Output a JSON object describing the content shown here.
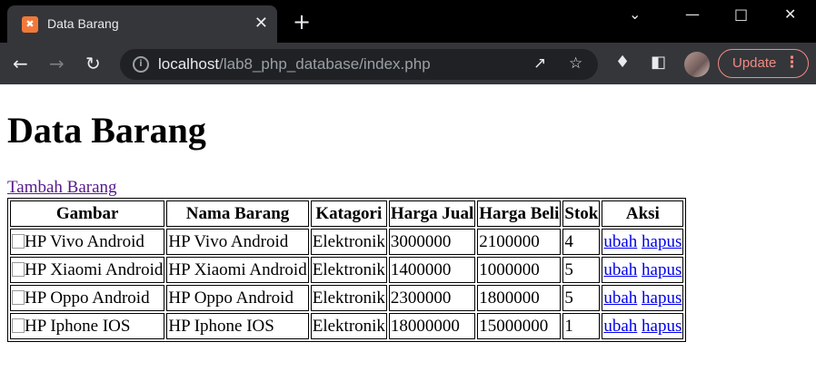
{
  "browser": {
    "tab_title": "Data Barang",
    "url_host": "localhost",
    "url_path": "/lab8_php_database/index.php",
    "update_label": "Update"
  },
  "page": {
    "heading": "Data Barang",
    "add_link": "Tambah Barang",
    "columns": [
      "Gambar",
      "Nama Barang",
      "Katagori",
      "Harga Jual",
      "Harga Beli",
      "Stok",
      "Aksi"
    ],
    "rows": [
      {
        "gambar_alt": "HP Vivo Android",
        "nama": "HP Vivo Android",
        "kategori": "Elektronik",
        "harga_jual": "3000000",
        "harga_beli": "2100000",
        "stok": "4",
        "ubah": "ubah",
        "hapus": "hapus"
      },
      {
        "gambar_alt": "HP Xiaomi Android",
        "nama": "HP Xiaomi Android",
        "kategori": "Elektronik",
        "harga_jual": "1400000",
        "harga_beli": "1000000",
        "stok": "5",
        "ubah": "ubah",
        "hapus": "hapus"
      },
      {
        "gambar_alt": "HP Oppo Android",
        "nama": "HP Oppo Android",
        "kategori": "Elektronik",
        "harga_jual": "2300000",
        "harga_beli": "1800000",
        "stok": "5",
        "ubah": "ubah",
        "hapus": "hapus"
      },
      {
        "gambar_alt": "HP Iphone IOS",
        "nama": "HP Iphone IOS",
        "kategori": "Elektronik",
        "harga_jual": "18000000",
        "harga_beli": "15000000",
        "stok": "1",
        "ubah": "ubah",
        "hapus": "hapus"
      }
    ]
  },
  "icons": {
    "favicon": "xampp-icon",
    "back": "back-arrow-icon",
    "forward": "forward-arrow-icon",
    "reload": "reload-icon",
    "info": "info-icon",
    "share": "share-icon",
    "bookmark": "star-icon",
    "extensions": "puzzle-icon",
    "sidepanel": "side-panel-icon"
  }
}
